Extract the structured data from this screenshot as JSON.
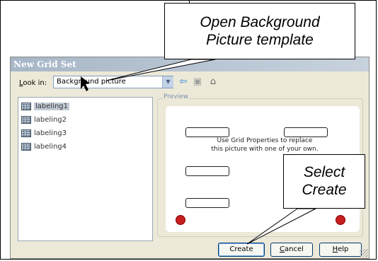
{
  "dialog": {
    "title": "New Grid Set",
    "look_in_label": "Look in:",
    "look_in_value": "Background picture",
    "icons": [
      "back-arrow-icon",
      "folder-up-icon",
      "home-icon"
    ],
    "files": [
      "labeling1",
      "labeling2",
      "labeling3",
      "labeling4"
    ],
    "selected_file": "labeling1",
    "preview_label": "Preview",
    "preview_text_line1": "Use Grid Properties to replace",
    "preview_text_line2": "this picture with one of your own.",
    "buttons": {
      "create": "Create",
      "cancel": "Cancel",
      "help": "Help"
    }
  },
  "callouts": {
    "top_line1": "Open Background",
    "top_line2": "Picture template",
    "bottom_line1": "Select",
    "bottom_line2": "Create"
  },
  "colors": {
    "title_bar": "#a7b6c7",
    "accent_red": "#c51f1f",
    "dialog_bg": "#ece9d8"
  }
}
